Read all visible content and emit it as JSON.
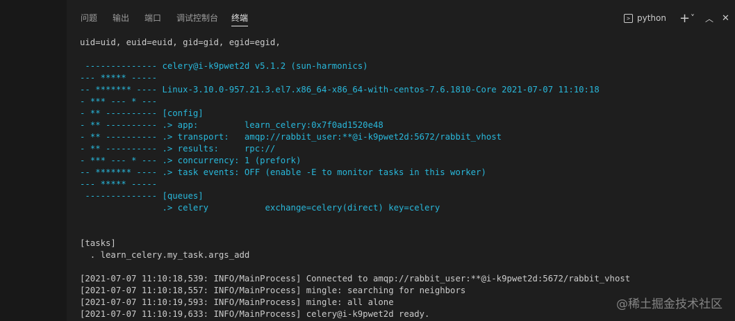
{
  "tabs": [
    {
      "label": "问题",
      "active": false
    },
    {
      "label": "输出",
      "active": false
    },
    {
      "label": "端口",
      "active": false
    },
    {
      "label": "调试控制台",
      "active": false
    },
    {
      "label": "终端",
      "active": true
    }
  ],
  "toolbar": {
    "terminal_name": "python",
    "add_label": "+",
    "dropdown_label": "˅",
    "maximize_label": "︿",
    "close_label": "✕"
  },
  "colors": {
    "accent_cyan": "#29b8db",
    "text": "#cccccc",
    "background": "#1e1e1e"
  },
  "terminal": {
    "lines": [
      "uid=uid, euid=euid, gid=gid, egid=egid,",
      "",
      " -------------- celery@i-k9pwet2d v5.1.2 (sun-harmonics)",
      "--- ***** -----",
      "-- ******* ---- Linux-3.10.0-957.21.3.el7.x86_64-x86_64-with-centos-7.6.1810-Core 2021-07-07 11:10:18",
      "- *** --- * ---",
      "- ** ---------- [config]",
      "- ** ---------- .> app:         learn_celery:0x7f0ad1520e48",
      "- ** ---------- .> transport:   amqp://rabbit_user:**@i-k9pwet2d:5672/rabbit_vhost",
      "- ** ---------- .> results:     rpc://",
      "- *** --- * --- .> concurrency: 1 (prefork)",
      "-- ******* ---- .> task events: OFF (enable -E to monitor tasks in this worker)",
      "--- ***** -----",
      " -------------- [queues]",
      "                .> celery           exchange=celery(direct) key=celery",
      "",
      "",
      "[tasks]",
      "  . learn_celery.my_task.args_add",
      "",
      "[2021-07-07 11:10:18,539: INFO/MainProcess] Connected to amqp://rabbit_user:**@i-k9pwet2d:5672/rabbit_vhost",
      "[2021-07-07 11:10:18,557: INFO/MainProcess] mingle: searching for neighbors",
      "[2021-07-07 11:10:19,593: INFO/MainProcess] mingle: all alone",
      "[2021-07-07 11:10:19,633: INFO/MainProcess] celery@i-k9pwet2d ready."
    ]
  },
  "watermark": "@稀土掘金技术社区"
}
